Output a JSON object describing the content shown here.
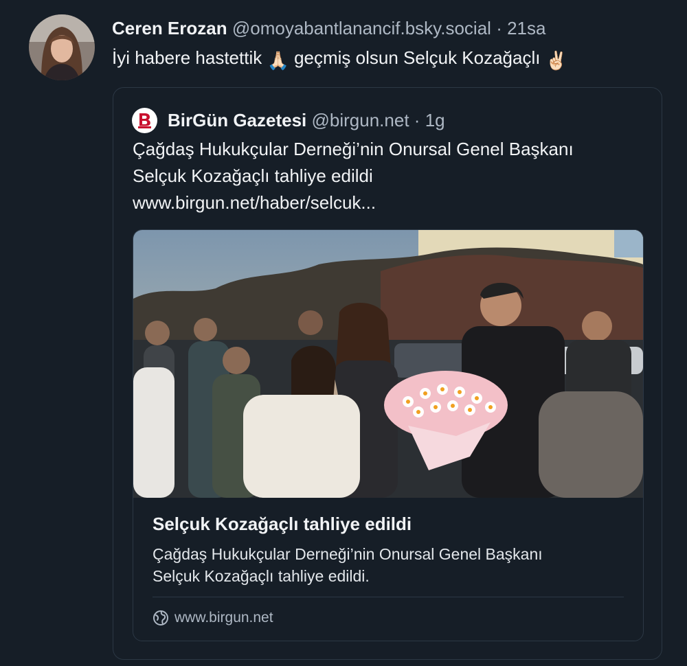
{
  "post": {
    "author_name": "Ceren Erozan",
    "handle": "@omoyabantlanancif.bsky.social",
    "separator": "·",
    "time": "21sa",
    "text_before": "İyi habere hastettik",
    "emoji1": "🙏🏻",
    "text_middle": "geçmiş olsun Selçuk Kozağaçlı",
    "emoji2": "✌🏻"
  },
  "quote": {
    "author_name": "BirGün Gazetesi",
    "handle": "@birgun.net",
    "separator": "·",
    "time": "1g",
    "text_lines": [
      "Çağdaş Hukukçular Derneği’nin Onursal Genel Başkanı",
      "Selçuk Kozağaçlı tahliye edildi",
      "www.birgun.net/haber/selcuk..."
    ],
    "card": {
      "title": "Selçuk Kozağaçlı tahliye edildi",
      "description_lines": [
        "Çağdaş Hukukçular Derneği’nin Onursal Genel Başkanı",
        "Selçuk Kozağaçlı tahliye edildi."
      ],
      "domain": "www.birgun.net",
      "domain_icon": "globe-icon"
    }
  },
  "colors": {
    "background": "#161e27",
    "text": "#f1f3f5",
    "muted": "#aeb8c4",
    "border": "#2c3845"
  }
}
